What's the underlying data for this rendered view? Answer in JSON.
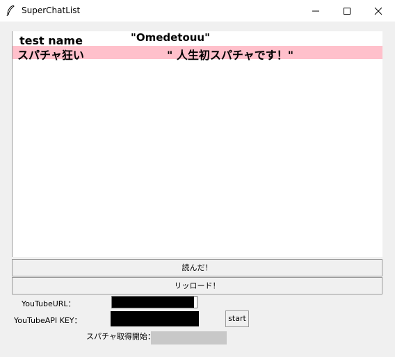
{
  "window": {
    "title": "SuperChatList",
    "icons": {
      "app": "feather-icon",
      "minimize": "minimize-icon",
      "maximize": "maximize-icon",
      "close": "close-icon"
    }
  },
  "list": {
    "rows": [
      {
        "name": "test name",
        "message": "\"Omedetouu\"",
        "highlight": "#ffffff"
      },
      {
        "name": "スパチャ狂い",
        "message": "\" 人生初スパチャです！\"",
        "highlight": "#ffc0cb"
      }
    ]
  },
  "buttons": {
    "read": "読んだ！",
    "reload": "リッロード！",
    "start": "start"
  },
  "form": {
    "youtube_url_label": "YouTubeURL：",
    "youtube_url_value": "",
    "api_key_label": "YouTubeAPI KEY：",
    "api_key_value": "",
    "start_status_label": "スパチャ取得開始：",
    "start_status_value": ""
  }
}
